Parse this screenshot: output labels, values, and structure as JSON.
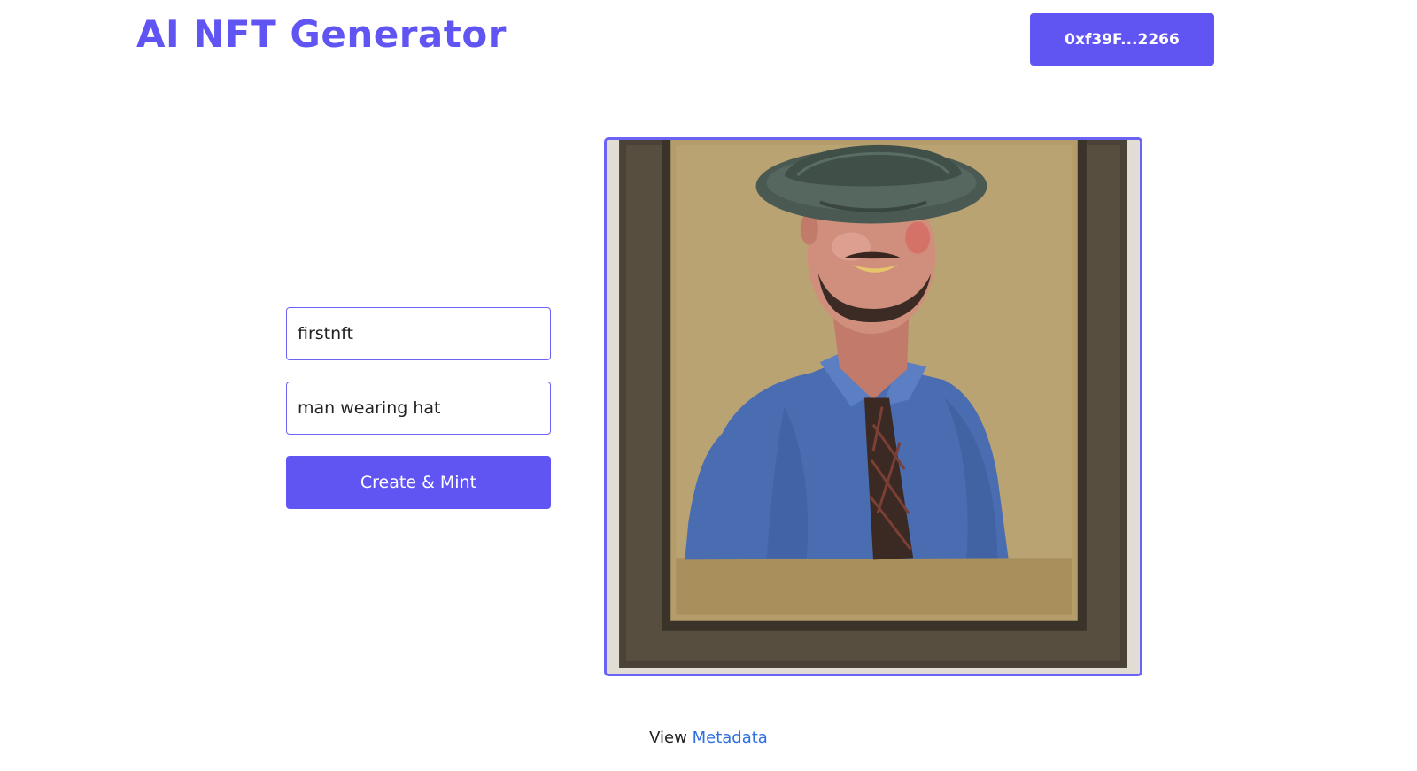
{
  "header": {
    "title": "AI NFT Generator",
    "wallet_label": "0xf39F...2266"
  },
  "form": {
    "name_value": "firstnft",
    "description_value": "man wearing hat",
    "submit_label": "Create & Mint"
  },
  "preview": {
    "alt": "man wearing hat"
  },
  "footer": {
    "prefix": "View",
    "link_label": "Metadata"
  },
  "colors": {
    "accent": "#6055f2",
    "link": "#2f6fe0"
  }
}
